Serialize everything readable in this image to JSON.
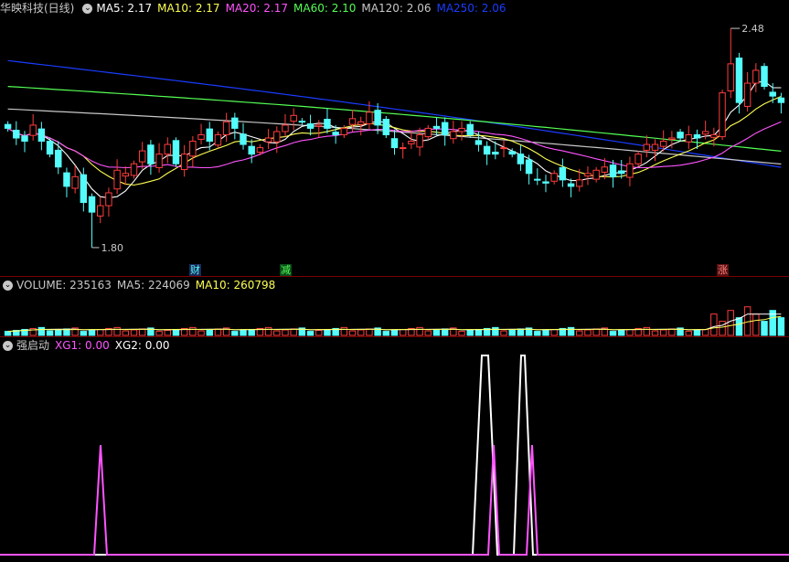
{
  "colors": {
    "up": "#ff3c3c",
    "down": "#54fcfc",
    "ma5": "#ffffff",
    "ma10": "#ffff54",
    "ma20": "#ff54ff",
    "ma60": "#54ff54",
    "ma120": "#c8c8c8",
    "ma250": "#1a3cff",
    "volume": "#c8c8c8",
    "xg1": "#ff54ff",
    "xg2": "#ffffff"
  },
  "price_pane": {
    "title": "华映科技(日线)",
    "ma5": "MA5: 2.17",
    "ma10": "MA10: 2.17",
    "ma20": "MA20: 2.17",
    "ma60": "MA60: 2.10",
    "ma120": "MA120: 2.06",
    "ma250": "MA250: 2.06",
    "high_label": "2.48",
    "low_label": "1.80",
    "tags": [
      {
        "text": "财",
        "color": "#54fcfc",
        "bg": "#1a2a5a"
      },
      {
        "text": "减",
        "color": "#54ff54",
        "bg": "#0a4a1a"
      },
      {
        "text": "涨",
        "color": "#ff8080",
        "bg": "#5a1010"
      }
    ]
  },
  "volume_pane": {
    "title": "VOLUME: 235163",
    "ma5": "MA5: 224069",
    "ma10": "MA10: 260798"
  },
  "indicator_pane": {
    "title": "强启动",
    "xg1": "XG1: 0.00",
    "xg2": "XG2: 0.00"
  },
  "chart_data": [
    {
      "type": "candlestick",
      "title": "华映科技(日线)",
      "price_range": [
        1.8,
        2.48
      ],
      "ma_last": {
        "MA5": 2.17,
        "MA10": 2.17,
        "MA20": 2.17,
        "MA60": 2.1,
        "MA120": 2.06,
        "MA250": 2.06
      },
      "close": [
        2.17,
        2.14,
        2.13,
        2.18,
        2.13,
        2.09,
        2.05,
        1.99,
        2.02,
        1.94,
        1.91,
        1.93,
        1.97,
        2.04,
        2.03,
        2.06,
        2.1,
        2.06,
        2.09,
        2.12,
        2.06,
        2.09,
        2.13,
        2.15,
        2.13,
        2.15,
        2.19,
        2.17,
        2.12,
        2.09,
        2.11,
        2.14,
        2.16,
        2.18,
        2.21,
        2.19,
        2.17,
        2.18,
        2.17,
        2.15,
        2.17,
        2.2,
        2.19,
        2.22,
        2.18,
        2.15,
        2.11,
        2.11,
        2.13,
        2.15,
        2.17,
        2.17,
        2.15,
        2.16,
        2.17,
        2.15,
        2.12,
        2.09,
        2.09,
        2.11,
        2.09,
        2.06,
        2.03,
        2.01,
        2.0,
        2.03,
        2.01,
        1.99,
        2.01,
        2.03,
        2.04,
        2.05,
        2.02,
        2.03,
        2.06,
        2.09,
        2.12,
        2.12,
        2.13,
        2.14,
        2.14,
        2.15,
        2.14,
        2.16,
        2.15,
        2.28,
        2.37,
        2.25,
        2.31,
        2.35,
        2.3,
        2.27,
        2.25
      ]
    },
    {
      "type": "bar",
      "title": "VOLUME",
      "ma_last": {
        "MA5": 224069,
        "MA10": 260798
      },
      "last": 235163
    },
    {
      "type": "line",
      "title": "强启动",
      "series": [
        {
          "name": "XG1",
          "last": 0.0
        },
        {
          "name": "XG2",
          "last": 0.0
        }
      ]
    }
  ]
}
